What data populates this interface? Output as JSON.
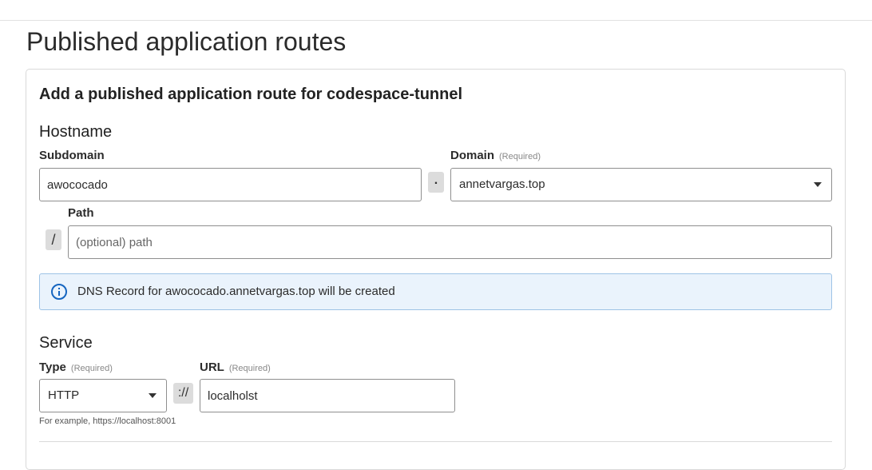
{
  "page": {
    "title": "Published application routes"
  },
  "form": {
    "title": "Add a published application route for codespace-tunnel",
    "hostname": {
      "section_title": "Hostname",
      "subdomain_label": "Subdomain",
      "subdomain_value": "awococado",
      "dot_separator": ".",
      "domain_label": "Domain",
      "domain_required": "(Required)",
      "domain_value": "annetvargas.top",
      "slash_separator": "/",
      "path_label": "Path",
      "path_placeholder": "(optional) path"
    },
    "info": {
      "icon": "info-icon",
      "message": "DNS Record for awococado.annetvargas.top will be created"
    },
    "service": {
      "section_title": "Service",
      "type_label": "Type",
      "type_required": "(Required)",
      "type_value": "HTTP",
      "scheme_separator": "://",
      "url_label": "URL",
      "url_required": "(Required)",
      "url_value": "localholst",
      "hint": "For example, https://localhost:8001"
    }
  }
}
